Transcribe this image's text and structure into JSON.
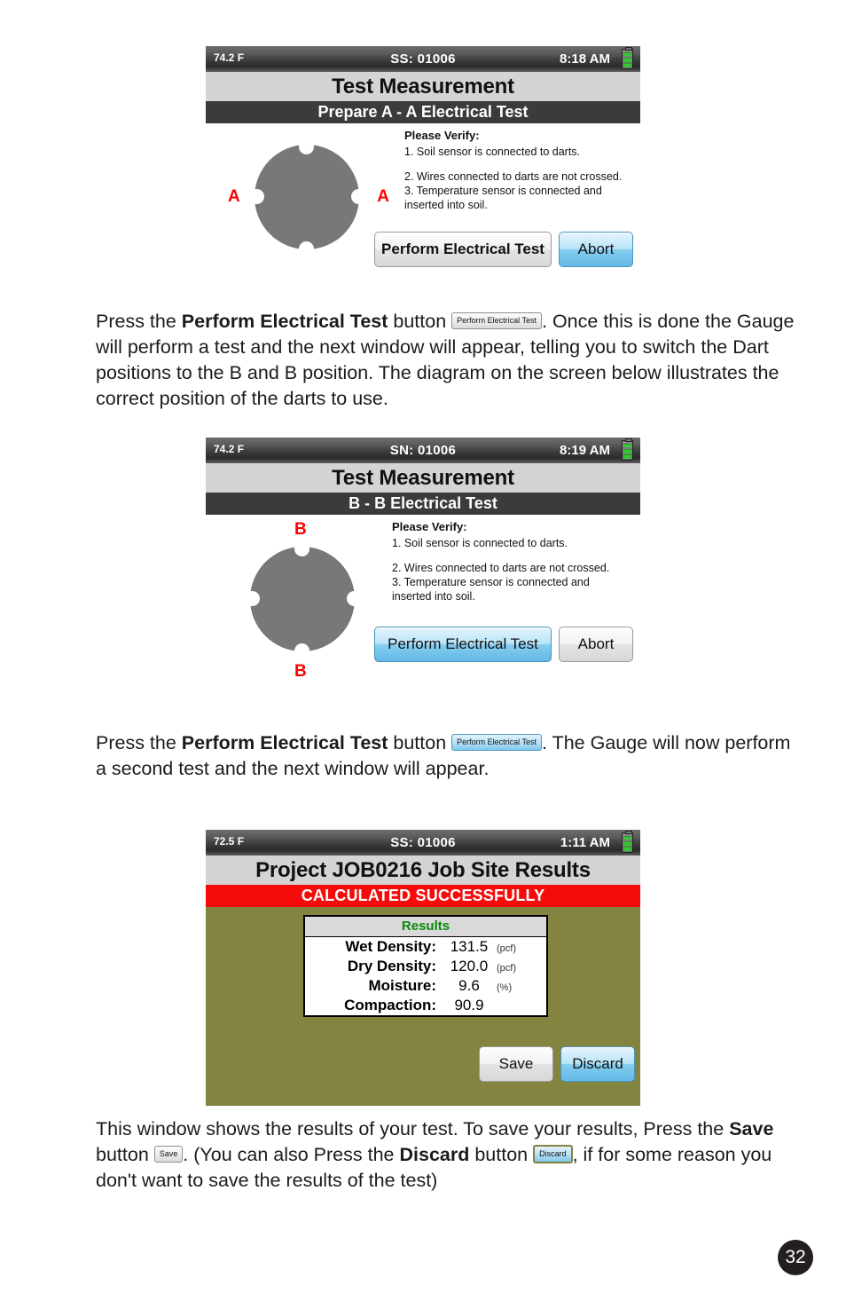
{
  "document": {
    "page_number": "32"
  },
  "screens": [
    {
      "id": "screen-prepare-aa",
      "status": {
        "temperature": "74.2 F",
        "serial": "SS: 01006",
        "time": "8:18 AM",
        "battery_icon": "battery-icon"
      },
      "title": "Test Measurement",
      "subtitle": "Prepare A - A Electrical Test",
      "diagram": {
        "name": "dart-position-diagram",
        "label_left": "A",
        "label_right": "A"
      },
      "verify": {
        "heading": "Please Verify:",
        "items": [
          "1.  Soil sensor is connected to darts.",
          "2.  Wires connected to darts are not crossed.",
          "3.  Temperature sensor is connected and inserted into soil."
        ]
      },
      "buttons": {
        "primary": "Perform Electrical Test",
        "secondary": "Abort",
        "primary_style": "grey",
        "secondary_style": "blue"
      }
    },
    {
      "id": "screen-bb-test",
      "status": {
        "temperature": "74.2 F",
        "serial": "SN: 01006",
        "time": "8:19 AM",
        "battery_icon": "battery-icon"
      },
      "title": "Test Measurement",
      "subtitle": "B - B Electrical Test",
      "diagram": {
        "name": "dart-position-diagram",
        "label_top": "B",
        "label_bottom": "B"
      },
      "verify": {
        "heading": "Please Verify:",
        "items": [
          "1.  Soil sensor is connected to darts.",
          "2.  Wires connected to darts are not crossed.",
          "3.  Temperature sensor is connected and inserted into soil."
        ]
      },
      "buttons": {
        "primary": "Perform Electrical Test",
        "secondary": "Abort",
        "primary_style": "blue",
        "secondary_style": "grey"
      }
    },
    {
      "id": "screen-results",
      "status": {
        "temperature": "72.5 F",
        "serial": "SS: 01006",
        "time": "1:11 AM",
        "battery_icon": "battery-icon"
      },
      "title": "Project JOB0216 Job Site Results",
      "subtitle": "CALCULATED SUCCESSFULLY",
      "subtitle_bg": "#f60b0b",
      "background": "#82843f",
      "results": {
        "header": "Results",
        "rows": [
          {
            "label": "Wet Density:",
            "value": "131.5",
            "unit": "(pcf)"
          },
          {
            "label": "Dry Density:",
            "value": "120.0",
            "unit": "(pcf)"
          },
          {
            "label": "Moisture:",
            "value": "9.6",
            "unit": "(%)"
          },
          {
            "label": "Compaction:",
            "value": "90.9",
            "unit": ""
          }
        ]
      },
      "buttons": {
        "primary": "Save",
        "secondary": "Discard",
        "primary_style": "grey",
        "secondary_style": "blue"
      }
    }
  ],
  "prose": {
    "p1": {
      "t1": "Press the ",
      "b1": "Perform Electrical Test",
      "t2": " button ",
      "inline_button": "Perform Electrical Test",
      "t3": ". Once this is done the Gauge will perform a test and the next window will appear, telling you to switch the Dart positions to the B and B position. The diagram on the screen below illustrates the correct position of the darts to use."
    },
    "p2": {
      "t1": "Press the ",
      "b1": "Perform Electrical Test",
      "t2": " button ",
      "inline_button": "Perform Electrical Test",
      "t3": ". The Gauge will now perform a second test and the next window will appear."
    },
    "p3": {
      "t1": "This window shows the results of your test. To save your results, Press the ",
      "b1": "Save",
      "t2": " button ",
      "inline_button_save": "Save",
      "t3": ". (You can also Press the ",
      "b2": "Discard",
      "t4": " button ",
      "inline_button_discard": "Discard",
      "t5": ", if for some reason you don't want to save the results of the test)"
    }
  }
}
